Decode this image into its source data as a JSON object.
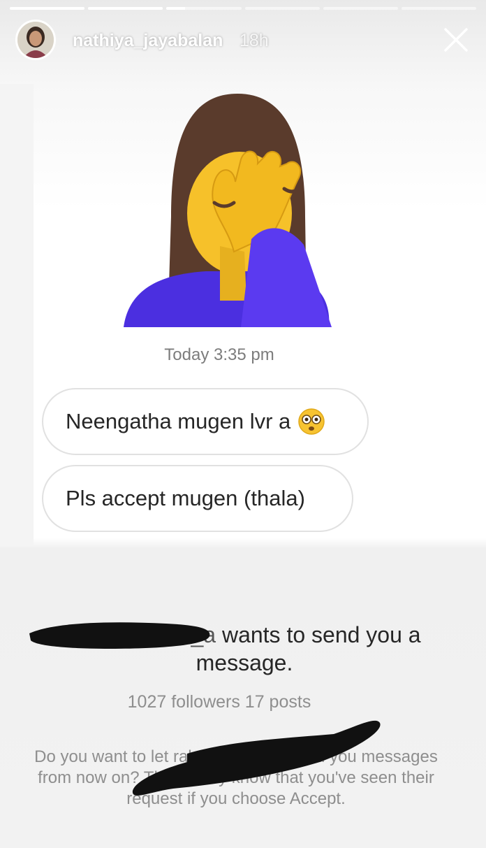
{
  "story": {
    "username": "nathiya_jayabalan",
    "time_ago": "18h",
    "segments": [
      1,
      1,
      0.25,
      0,
      0,
      0
    ]
  },
  "thread": {
    "timestamp": "Today 3:35 pm",
    "messages": [
      {
        "text": "Neengatha mugen lvr a",
        "emoji": "flushed-face"
      },
      {
        "text": "Pls accept mugen (thala)"
      }
    ]
  },
  "request": {
    "sender": "rahman_mis_a",
    "text": "wants to send you a message.",
    "stats": "1027 followers 17 posts",
    "description": "Do you want to let rahman_mis_a send you messages from now on? They'll only know that you've seen their request if you choose Accept."
  },
  "colors": {
    "accent_bubble_border": "#e1e1e1",
    "scribble": "#111111"
  }
}
